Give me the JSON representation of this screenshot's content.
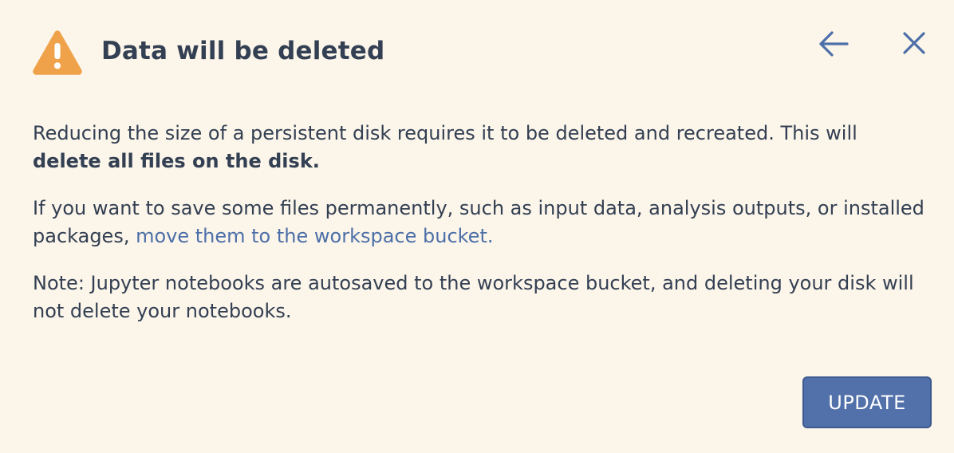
{
  "dialog": {
    "title": "Data will be deleted",
    "icons": {
      "warning": "warning-triangle-icon",
      "back": "arrow-left-icon",
      "close": "close-icon"
    },
    "colors": {
      "background": "#fbf5ea",
      "warning": "#efa24a",
      "text": "#333f52",
      "link": "#4d6fa8",
      "button": "#5270a9",
      "button_text": "#ffffff"
    }
  },
  "body": {
    "para1_text": "Reducing the size of a persistent disk requires it to be deleted and recreated. This will ",
    "para1_bold": "delete all files on the disk.",
    "para2_text": "If you want to save some files permanently, such as input data, analysis outputs, or installed packages, ",
    "para2_link": "move them to the workspace bucket.",
    "para3_text": "Note: Jupyter notebooks are autosaved to the workspace bucket, and deleting your disk will not delete your notebooks."
  },
  "footer": {
    "update_label": "UPDATE"
  }
}
